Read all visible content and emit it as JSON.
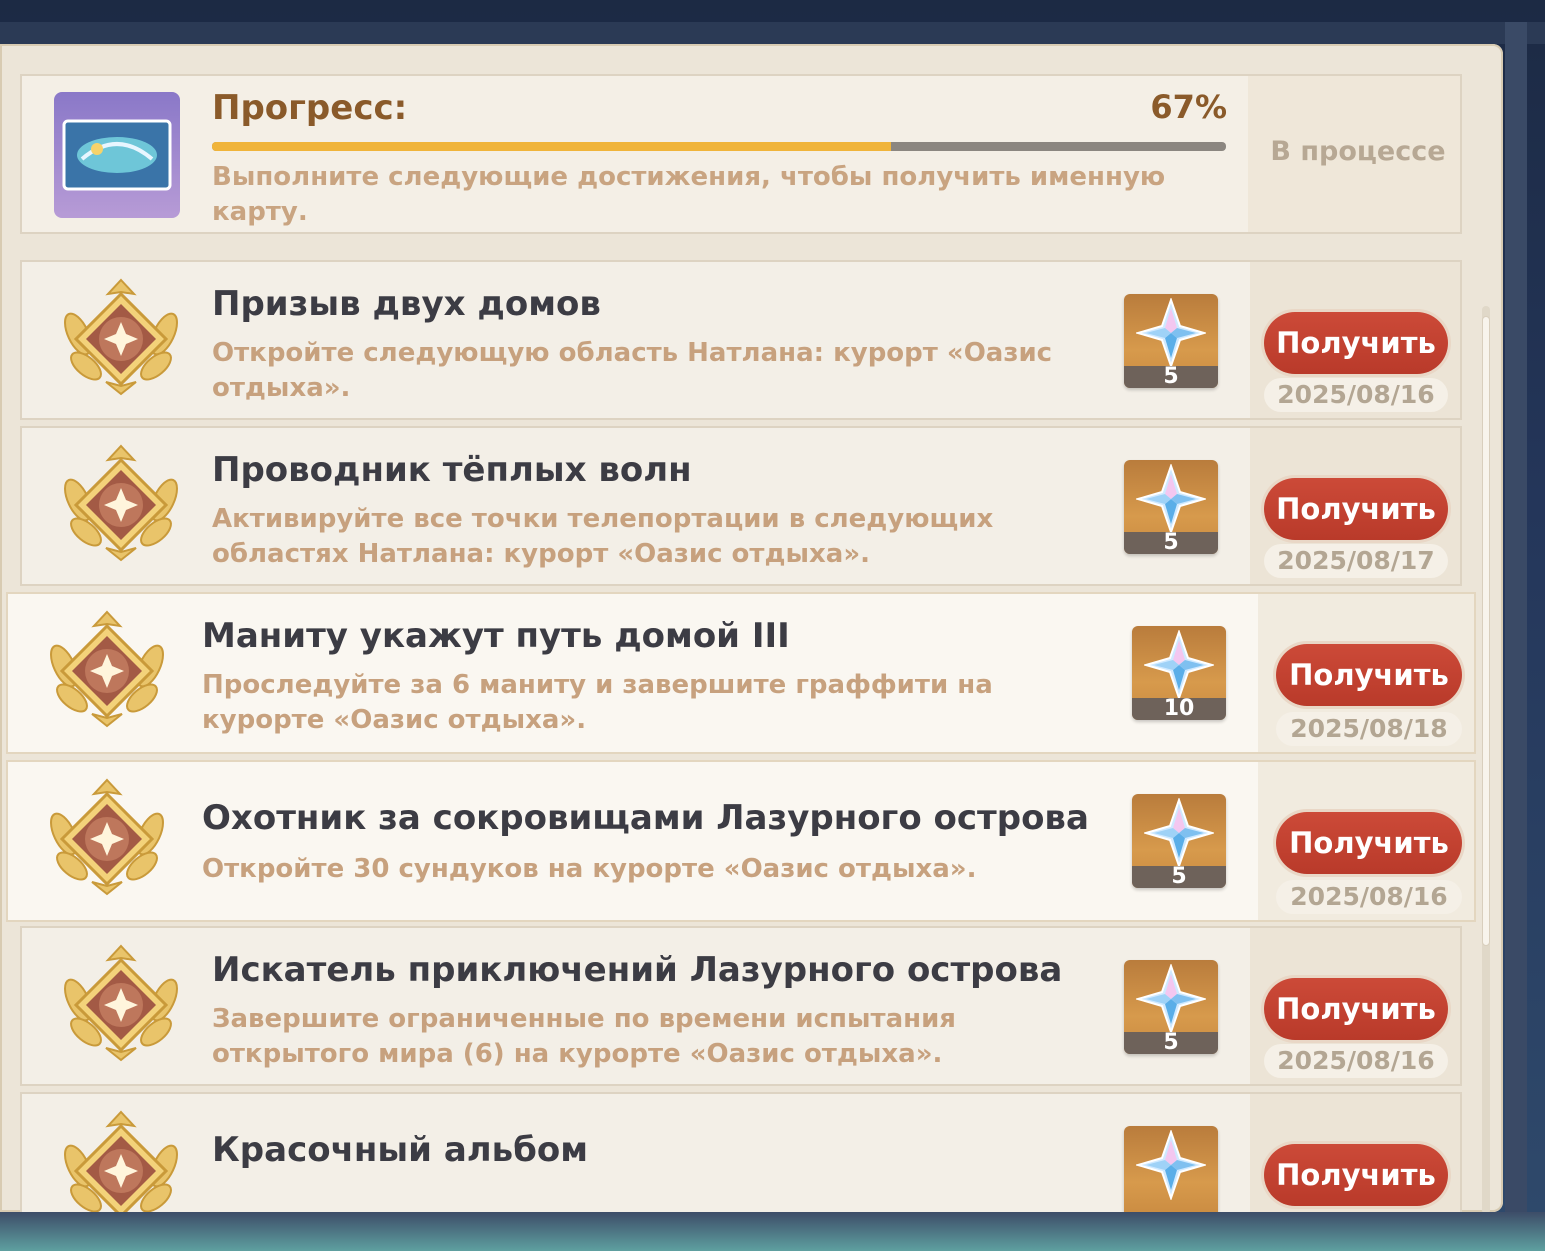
{
  "progress": {
    "label": "Прогресс:",
    "percent_text": "67%",
    "fraction": 0.67,
    "description": "Выполните следующие достижения, чтобы получить именную карту.",
    "status": "В процессе"
  },
  "achievements": [
    {
      "title": "Призыв двух домов",
      "description": "Откройте следующую область Натлана: курорт «Оазис отдыха».",
      "reward_count": "5",
      "button": "Получить",
      "date": "2025/08/16"
    },
    {
      "title": "Проводник тёплых волн",
      "description": "Активируйте все точки телепортации в следующих областях Натлана: курорт «Оазис отдыха».",
      "reward_count": "5",
      "button": "Получить",
      "date": "2025/08/17"
    },
    {
      "title": "Маниту укажут путь домой III",
      "description": "Проследуйте за 6 маниту и завершите граффити на курорте «Оазис отдыха».",
      "reward_count": "10",
      "button": "Получить",
      "date": "2025/08/18"
    },
    {
      "title": "Охотник за сокровищами Лазурного острова",
      "description": "Откройте 30 сундуков на курорте «Оазис отдыха».",
      "reward_count": "5",
      "button": "Получить",
      "date": "2025/08/16"
    },
    {
      "title": "Искатель приключений Лазурного острова",
      "description": "Завершите ограниченные по времени испытания открытого мира (6) на курорте «Оазис отдыха».",
      "reward_count": "5",
      "button": "Получить",
      "date": "2025/08/16"
    },
    {
      "title": "Красочный альбом",
      "button": "Получить"
    }
  ],
  "colors": {
    "accent_button": "#c4412f",
    "progress_fill": "#f0b43a",
    "title_text": "#3c3c44",
    "desc_text": "#c7a17e"
  }
}
